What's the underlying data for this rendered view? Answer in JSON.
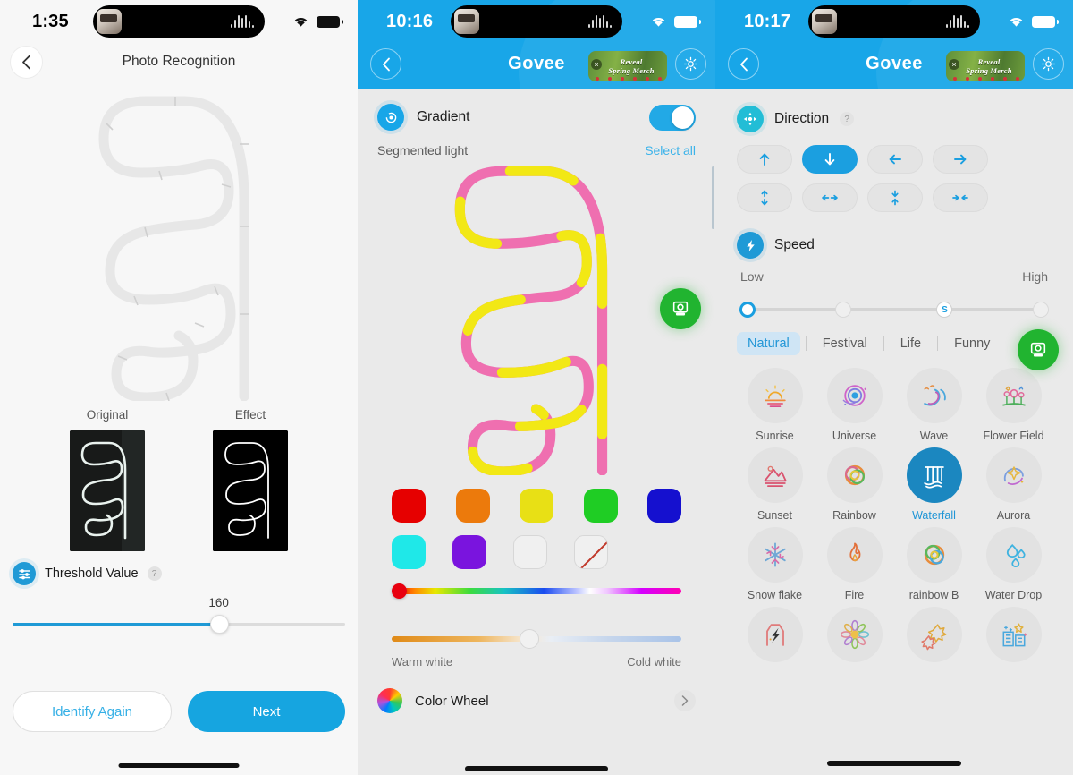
{
  "panel1": {
    "status": {
      "time": "1:35",
      "wifi_icon": "wifi-icon",
      "battery_icon": "battery-icon"
    },
    "nav": {
      "back_icon": "chevron-left-icon",
      "title": "Photo Recognition"
    },
    "compare": [
      {
        "label": "Original",
        "name": "original-preview"
      },
      {
        "label": "Effect",
        "name": "effect-preview"
      }
    ],
    "threshold": {
      "icon": "sliders-icon",
      "title": "Threshold Value",
      "help": "?",
      "value": "160",
      "percent": 62
    },
    "buttons": {
      "secondary": "Identify Again",
      "primary": "Next"
    }
  },
  "panel2": {
    "status": {
      "time": "10:16",
      "wifi_icon": "wifi-icon",
      "battery_icon": "battery-icon"
    },
    "header": {
      "back_icon": "chevron-left-icon",
      "logo": "Govee",
      "banner_line1": "Reveal",
      "banner_line2": "Spring Merch",
      "banner_close": "×",
      "gear_icon": "gear-icon"
    },
    "gradient": {
      "icon": "gradient-icon",
      "label": "Gradient",
      "toggle_on": true
    },
    "segmented": {
      "label": "Segmented light",
      "select_all": "Select all"
    },
    "swatches_row1": [
      "#e60000",
      "#ec7a0c",
      "#e8e015",
      "#1fcd24",
      "#1510cf"
    ],
    "swatches_row2": [
      "#1fe8e8",
      "#7a14de",
      "empty",
      "none"
    ],
    "hue_slider": {
      "knob_percent": 0,
      "knob_color": "#e8000f"
    },
    "cct_slider": {
      "knob_percent": 44,
      "left_label": "Warm white",
      "right_label": "Cold white"
    },
    "color_wheel": {
      "icon": "color-wheel-icon",
      "label": "Color Wheel",
      "chevron": "chevron-right-icon"
    },
    "fab": {
      "icon": "diy-camera-icon",
      "color": "#21b430"
    }
  },
  "panel3": {
    "status": {
      "time": "10:17",
      "wifi_icon": "wifi-icon",
      "battery_icon": "battery-icon"
    },
    "header": {
      "back_icon": "chevron-left-icon",
      "logo": "Govee",
      "banner_line1": "Reveal",
      "banner_line2": "Spring Merch",
      "banner_close": "×",
      "gear_icon": "gear-icon"
    },
    "direction": {
      "icon": "direction-icon",
      "title": "Direction",
      "help": "?",
      "options": [
        {
          "name": "arrow-up-icon",
          "selected": false
        },
        {
          "name": "arrow-down-icon",
          "selected": true
        },
        {
          "name": "arrow-left-icon",
          "selected": false
        },
        {
          "name": "arrow-right-icon",
          "selected": false
        },
        {
          "name": "arrows-vertical-out-icon",
          "selected": false
        },
        {
          "name": "arrows-horizontal-out-icon",
          "selected": false
        },
        {
          "name": "arrows-vertical-in-icon",
          "selected": false
        },
        {
          "name": "arrows-horizontal-in-icon",
          "selected": false
        }
      ]
    },
    "speed": {
      "icon": "speed-icon",
      "title": "Speed",
      "low_label": "Low",
      "high_label": "High",
      "points": 4,
      "selected_index": 0,
      "marker_index": 2,
      "marker_glyph": "S"
    },
    "tabs": [
      {
        "label": "Natural",
        "active": true
      },
      {
        "label": "Festival",
        "active": false
      },
      {
        "label": "Life",
        "active": false
      },
      {
        "label": "Funny",
        "active": false
      }
    ],
    "tabs_more": "›",
    "scenes": [
      {
        "label": "Sunrise",
        "icon": "sunrise-icon",
        "selected": false
      },
      {
        "label": "Universe",
        "icon": "universe-icon",
        "selected": false
      },
      {
        "label": "Wave",
        "icon": "wave-icon",
        "selected": false
      },
      {
        "label": "Flower Field",
        "icon": "flower-field-icon",
        "selected": false
      },
      {
        "label": "Sunset",
        "icon": "sunset-icon",
        "selected": false
      },
      {
        "label": "Rainbow",
        "icon": "rainbow-icon",
        "selected": false
      },
      {
        "label": "Waterfall",
        "icon": "waterfall-icon",
        "selected": true
      },
      {
        "label": "Aurora",
        "icon": "aurora-icon",
        "selected": false
      },
      {
        "label": "Snow flake",
        "icon": "snowflake-icon",
        "selected": false
      },
      {
        "label": "Fire",
        "icon": "fire-icon",
        "selected": false
      },
      {
        "label": "rainbow B",
        "icon": "rainbow-b-icon",
        "selected": false
      },
      {
        "label": "Water Drop",
        "icon": "water-drop-icon",
        "selected": false
      },
      {
        "label": "",
        "icon": "lightning-icon",
        "selected": false
      },
      {
        "label": "",
        "icon": "flower-icon",
        "selected": false
      },
      {
        "label": "",
        "icon": "leaves-icon",
        "selected": false
      },
      {
        "label": "",
        "icon": "city-icon",
        "selected": false
      }
    ],
    "fab": {
      "icon": "diy-camera-icon",
      "color": "#21b430"
    }
  }
}
